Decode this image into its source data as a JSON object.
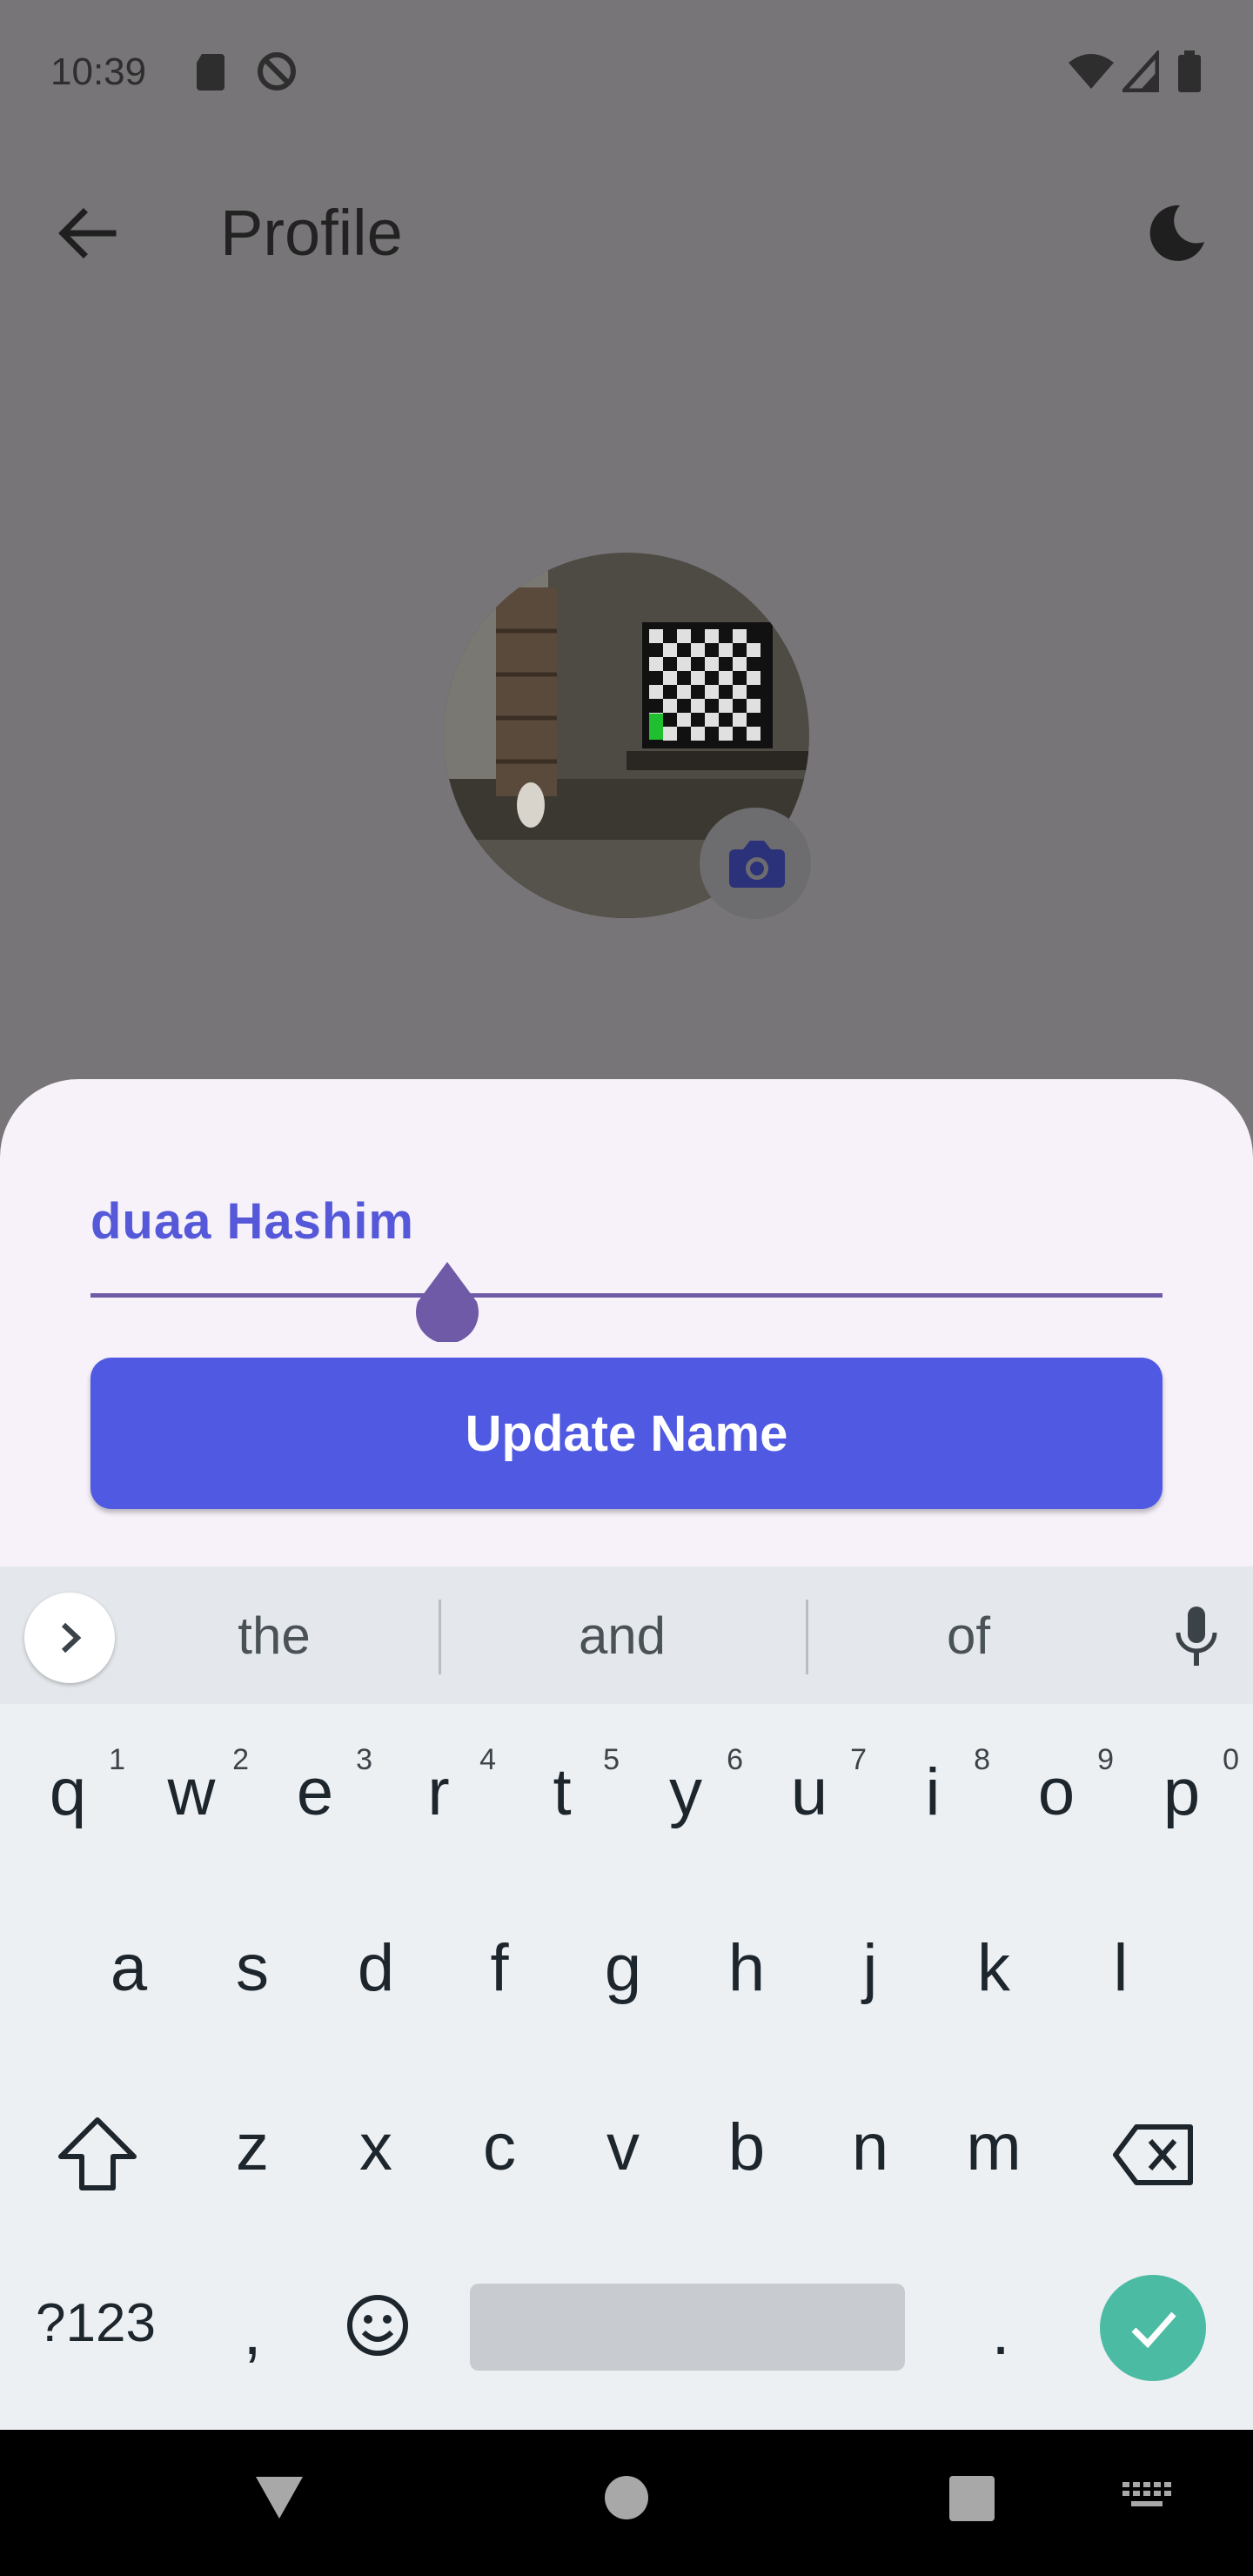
{
  "status_bar": {
    "time": "10:39",
    "icons": [
      "sd-card-icon",
      "do-not-disturb-icon",
      "wifi-icon",
      "signal-icon",
      "battery-icon"
    ]
  },
  "app_bar": {
    "title": "Profile",
    "back_icon": "arrow-back-icon",
    "theme_icon": "dark-mode-moon-icon"
  },
  "profile": {
    "camera_icon": "camera-icon"
  },
  "sheet": {
    "name_value": "duaa Hashim",
    "update_button_label": "Update Name"
  },
  "keyboard": {
    "suggestions": [
      "the",
      "and",
      "of"
    ],
    "row1": [
      {
        "k": "q",
        "h": "1"
      },
      {
        "k": "w",
        "h": "2"
      },
      {
        "k": "e",
        "h": "3"
      },
      {
        "k": "r",
        "h": "4"
      },
      {
        "k": "t",
        "h": "5"
      },
      {
        "k": "y",
        "h": "6"
      },
      {
        "k": "u",
        "h": "7"
      },
      {
        "k": "i",
        "h": "8"
      },
      {
        "k": "o",
        "h": "9"
      },
      {
        "k": "p",
        "h": "0"
      }
    ],
    "row2": [
      "a",
      "s",
      "d",
      "f",
      "g",
      "h",
      "j",
      "k",
      "l"
    ],
    "row3": [
      "z",
      "x",
      "c",
      "v",
      "b",
      "n",
      "m"
    ],
    "symbols_label": "?123",
    "comma": ",",
    "period": "."
  },
  "colors": {
    "accent": "#5059e2",
    "name_text": "#5558d8",
    "handle": "#6e5aa6",
    "done_key": "#4cbba3"
  }
}
